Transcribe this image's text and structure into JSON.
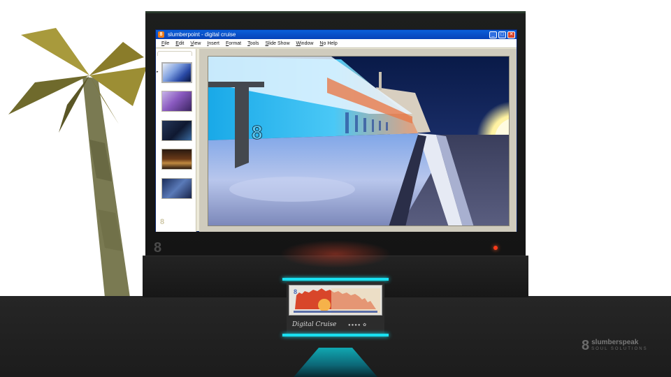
{
  "window": {
    "title": "slumberpoint - digital cruise",
    "app_icon": "8",
    "controls": {
      "minimize": "_",
      "maximize": "□",
      "close": "✕"
    }
  },
  "menu": {
    "items": [
      "File",
      "Edit",
      "View",
      "Insert",
      "Format",
      "Tools",
      "Slide Show",
      "Window",
      "No Help"
    ]
  },
  "slides": {
    "count": 5,
    "selected_index": 1,
    "pointer": "▸",
    "sidebar_logo": "8",
    "thumb_colors": [
      "#3a5fb0",
      "#7a4aa8",
      "#1d2a4a",
      "#4a2a14",
      "#1f2f5c"
    ]
  },
  "slide_main": {
    "logo_glyph": "8",
    "sky_color": "#0b1a4a",
    "sun_color": "#fff8c0"
  },
  "monitor": {
    "logo": "8"
  },
  "mini_device": {
    "brand": "Digital Cruise",
    "dots": "●●●● ✿"
  },
  "corner_brand": {
    "mark": "8",
    "name": "slumberspeak",
    "tagline": "SOUL SOLUTIONS"
  }
}
